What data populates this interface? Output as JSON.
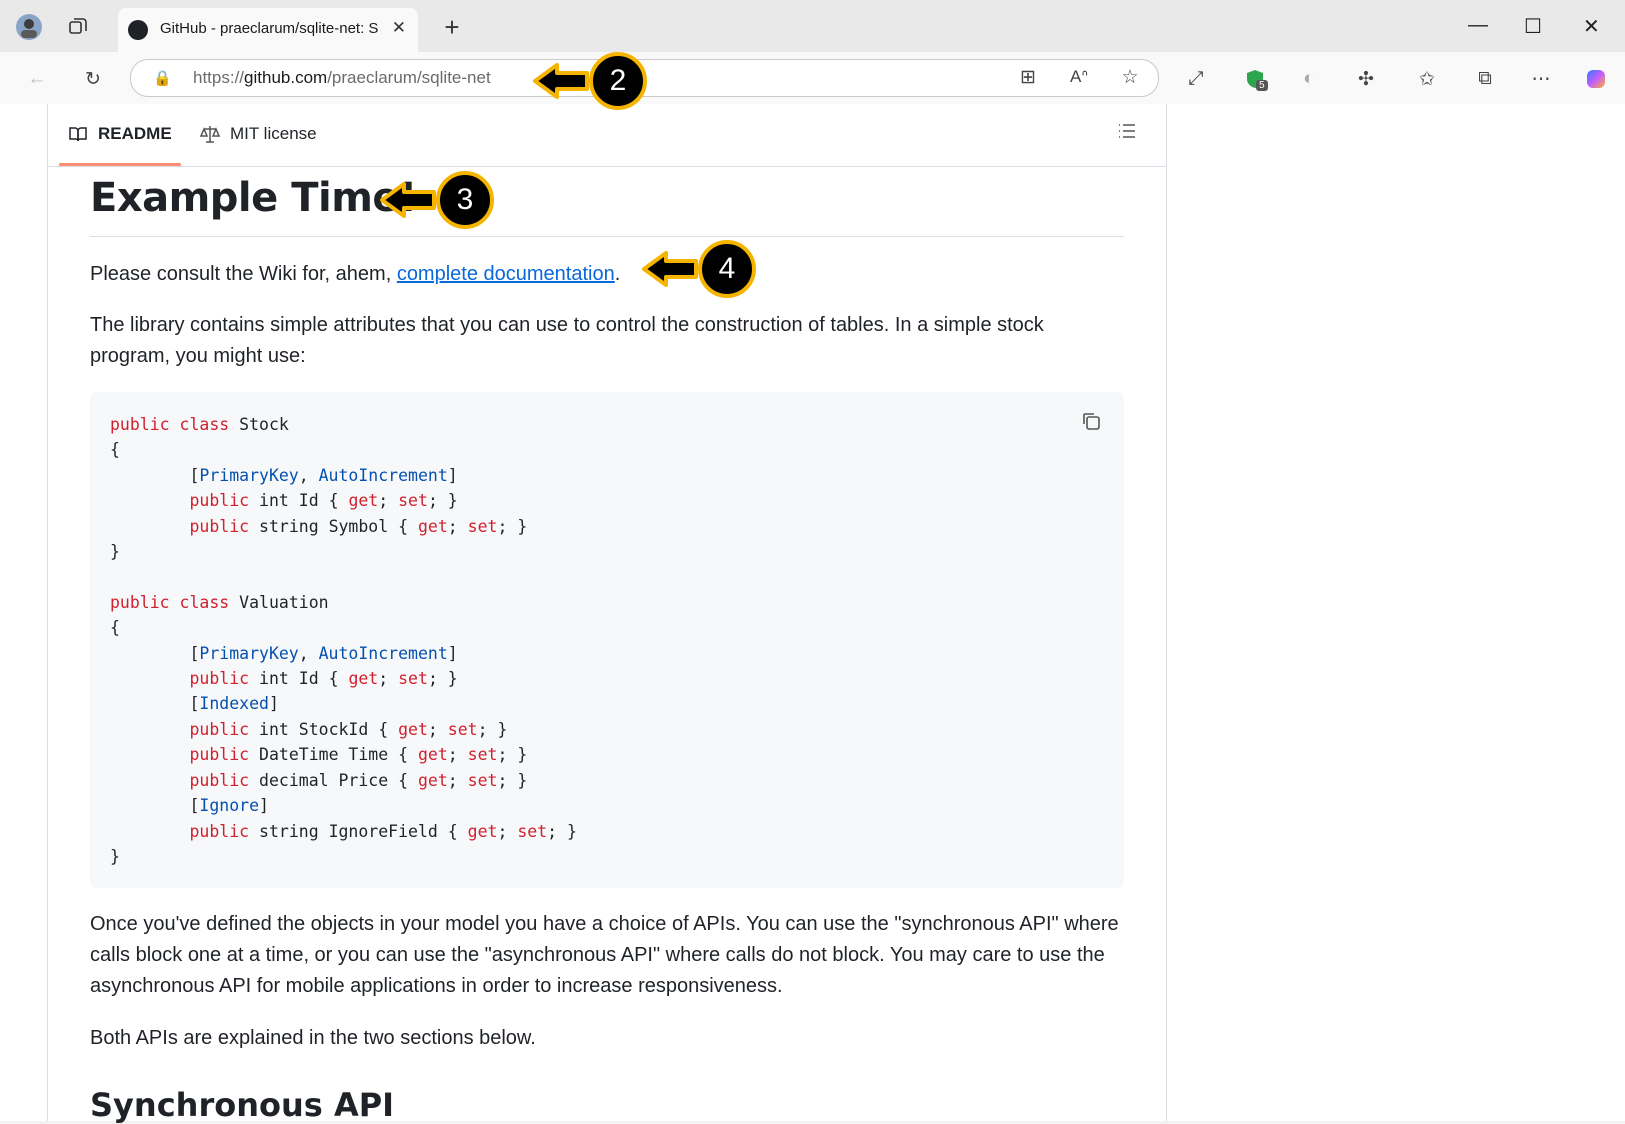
{
  "browser": {
    "tab_title": "GitHub - praeclarum/sqlite-net: S",
    "url_prefix": "https://",
    "url_domain": "github.com",
    "url_path": "/praeclarum/sqlite-net",
    "extension_badge": "5"
  },
  "readme_bar": {
    "readme_label": "README",
    "license_label": "MIT license"
  },
  "content": {
    "heading": "Example Time!",
    "wiki_prefix": "Please consult the Wiki for, ahem, ",
    "wiki_link": "complete documentation",
    "wiki_suffix": ".",
    "intro": "The library contains simple attributes that you can use to control the construction of tables. In a simple stock program, you might use:",
    "apis_paragraph": "Once you've defined the objects in your model you have a choice of APIs. You can use the \"synchronous API\" where calls block one at a time, or you can use the \"asynchronous API\" where calls do not block. You may care to use the asynchronous API for mobile applications in order to increase responsiveness.",
    "both_paragraph": "Both APIs are explained in the two sections below.",
    "subheading": "Synchronous API"
  },
  "code": [
    [
      [
        "kw",
        "public"
      ],
      [
        "t",
        " "
      ],
      [
        "kw",
        "class"
      ],
      [
        "t",
        " Stock"
      ]
    ],
    [
      [
        "t",
        "{"
      ]
    ],
    [
      [
        "t",
        "        ["
      ],
      [
        "at",
        "PrimaryKey"
      ],
      [
        "t",
        ", "
      ],
      [
        "at",
        "AutoIncrement"
      ],
      [
        "t",
        "]"
      ]
    ],
    [
      [
        "t",
        "        "
      ],
      [
        "kw",
        "public"
      ],
      [
        "t",
        " int Id { "
      ],
      [
        "kw",
        "get"
      ],
      [
        "t",
        "; "
      ],
      [
        "kw",
        "set"
      ],
      [
        "t",
        "; }"
      ]
    ],
    [
      [
        "t",
        "        "
      ],
      [
        "kw",
        "public"
      ],
      [
        "t",
        " string Symbol { "
      ],
      [
        "kw",
        "get"
      ],
      [
        "t",
        "; "
      ],
      [
        "kw",
        "set"
      ],
      [
        "t",
        "; }"
      ]
    ],
    [
      [
        "t",
        "}"
      ]
    ],
    [
      [
        "t",
        ""
      ]
    ],
    [
      [
        "kw",
        "public"
      ],
      [
        "t",
        " "
      ],
      [
        "kw",
        "class"
      ],
      [
        "t",
        " Valuation"
      ]
    ],
    [
      [
        "t",
        "{"
      ]
    ],
    [
      [
        "t",
        "        ["
      ],
      [
        "at",
        "PrimaryKey"
      ],
      [
        "t",
        ", "
      ],
      [
        "at",
        "AutoIncrement"
      ],
      [
        "t",
        "]"
      ]
    ],
    [
      [
        "t",
        "        "
      ],
      [
        "kw",
        "public"
      ],
      [
        "t",
        " int Id { "
      ],
      [
        "kw",
        "get"
      ],
      [
        "t",
        "; "
      ],
      [
        "kw",
        "set"
      ],
      [
        "t",
        "; }"
      ]
    ],
    [
      [
        "t",
        "        ["
      ],
      [
        "at",
        "Indexed"
      ],
      [
        "t",
        "]"
      ]
    ],
    [
      [
        "t",
        "        "
      ],
      [
        "kw",
        "public"
      ],
      [
        "t",
        " int StockId { "
      ],
      [
        "kw",
        "get"
      ],
      [
        "t",
        "; "
      ],
      [
        "kw",
        "set"
      ],
      [
        "t",
        "; }"
      ]
    ],
    [
      [
        "t",
        "        "
      ],
      [
        "kw",
        "public"
      ],
      [
        "t",
        " DateTime Time { "
      ],
      [
        "kw",
        "get"
      ],
      [
        "t",
        "; "
      ],
      [
        "kw",
        "set"
      ],
      [
        "t",
        "; }"
      ]
    ],
    [
      [
        "t",
        "        "
      ],
      [
        "kw",
        "public"
      ],
      [
        "t",
        " decimal Price { "
      ],
      [
        "kw",
        "get"
      ],
      [
        "t",
        "; "
      ],
      [
        "kw",
        "set"
      ],
      [
        "t",
        "; }"
      ]
    ],
    [
      [
        "t",
        "        ["
      ],
      [
        "at",
        "Ignore"
      ],
      [
        "t",
        "]"
      ]
    ],
    [
      [
        "t",
        "        "
      ],
      [
        "kw",
        "public"
      ],
      [
        "t",
        " string IgnoreField { "
      ],
      [
        "kw",
        "get"
      ],
      [
        "t",
        "; "
      ],
      [
        "kw",
        "set"
      ],
      [
        "t",
        "; }"
      ]
    ],
    [
      [
        "t",
        "}"
      ]
    ]
  ],
  "callouts": {
    "c2": "2",
    "c3": "3",
    "c4": "4"
  },
  "colors": {
    "callout_fill": "#000000",
    "callout_border": "#f5b400",
    "link": "#0969da",
    "keyword": "#cf222e",
    "attribute": "#0550ae"
  }
}
